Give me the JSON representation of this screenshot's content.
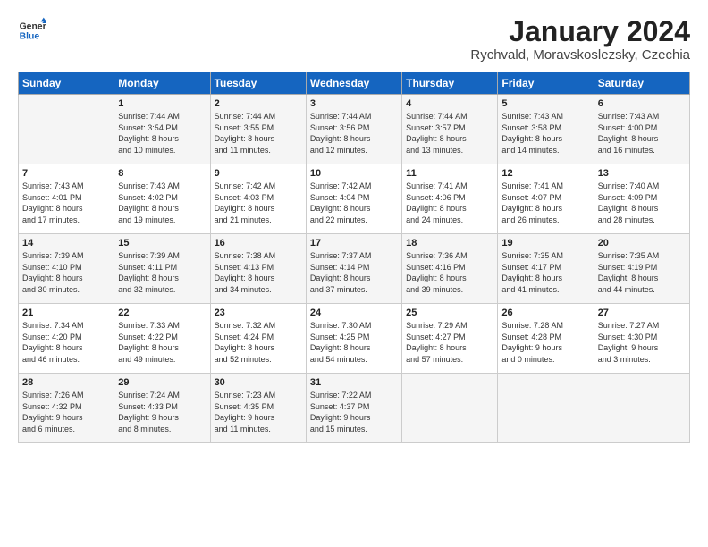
{
  "logo": {
    "line1": "General",
    "line2": "Blue"
  },
  "title": "January 2024",
  "subtitle": "Rychvald, Moravskoslezsky, Czechia",
  "days_of_week": [
    "Sunday",
    "Monday",
    "Tuesday",
    "Wednesday",
    "Thursday",
    "Friday",
    "Saturday"
  ],
  "weeks": [
    [
      {
        "day": "",
        "info": ""
      },
      {
        "day": "1",
        "info": "Sunrise: 7:44 AM\nSunset: 3:54 PM\nDaylight: 8 hours\nand 10 minutes."
      },
      {
        "day": "2",
        "info": "Sunrise: 7:44 AM\nSunset: 3:55 PM\nDaylight: 8 hours\nand 11 minutes."
      },
      {
        "day": "3",
        "info": "Sunrise: 7:44 AM\nSunset: 3:56 PM\nDaylight: 8 hours\nand 12 minutes."
      },
      {
        "day": "4",
        "info": "Sunrise: 7:44 AM\nSunset: 3:57 PM\nDaylight: 8 hours\nand 13 minutes."
      },
      {
        "day": "5",
        "info": "Sunrise: 7:43 AM\nSunset: 3:58 PM\nDaylight: 8 hours\nand 14 minutes."
      },
      {
        "day": "6",
        "info": "Sunrise: 7:43 AM\nSunset: 4:00 PM\nDaylight: 8 hours\nand 16 minutes."
      }
    ],
    [
      {
        "day": "7",
        "info": "Sunrise: 7:43 AM\nSunset: 4:01 PM\nDaylight: 8 hours\nand 17 minutes."
      },
      {
        "day": "8",
        "info": "Sunrise: 7:43 AM\nSunset: 4:02 PM\nDaylight: 8 hours\nand 19 minutes."
      },
      {
        "day": "9",
        "info": "Sunrise: 7:42 AM\nSunset: 4:03 PM\nDaylight: 8 hours\nand 21 minutes."
      },
      {
        "day": "10",
        "info": "Sunrise: 7:42 AM\nSunset: 4:04 PM\nDaylight: 8 hours\nand 22 minutes."
      },
      {
        "day": "11",
        "info": "Sunrise: 7:41 AM\nSunset: 4:06 PM\nDaylight: 8 hours\nand 24 minutes."
      },
      {
        "day": "12",
        "info": "Sunrise: 7:41 AM\nSunset: 4:07 PM\nDaylight: 8 hours\nand 26 minutes."
      },
      {
        "day": "13",
        "info": "Sunrise: 7:40 AM\nSunset: 4:09 PM\nDaylight: 8 hours\nand 28 minutes."
      }
    ],
    [
      {
        "day": "14",
        "info": "Sunrise: 7:39 AM\nSunset: 4:10 PM\nDaylight: 8 hours\nand 30 minutes."
      },
      {
        "day": "15",
        "info": "Sunrise: 7:39 AM\nSunset: 4:11 PM\nDaylight: 8 hours\nand 32 minutes."
      },
      {
        "day": "16",
        "info": "Sunrise: 7:38 AM\nSunset: 4:13 PM\nDaylight: 8 hours\nand 34 minutes."
      },
      {
        "day": "17",
        "info": "Sunrise: 7:37 AM\nSunset: 4:14 PM\nDaylight: 8 hours\nand 37 minutes."
      },
      {
        "day": "18",
        "info": "Sunrise: 7:36 AM\nSunset: 4:16 PM\nDaylight: 8 hours\nand 39 minutes."
      },
      {
        "day": "19",
        "info": "Sunrise: 7:35 AM\nSunset: 4:17 PM\nDaylight: 8 hours\nand 41 minutes."
      },
      {
        "day": "20",
        "info": "Sunrise: 7:35 AM\nSunset: 4:19 PM\nDaylight: 8 hours\nand 44 minutes."
      }
    ],
    [
      {
        "day": "21",
        "info": "Sunrise: 7:34 AM\nSunset: 4:20 PM\nDaylight: 8 hours\nand 46 minutes."
      },
      {
        "day": "22",
        "info": "Sunrise: 7:33 AM\nSunset: 4:22 PM\nDaylight: 8 hours\nand 49 minutes."
      },
      {
        "day": "23",
        "info": "Sunrise: 7:32 AM\nSunset: 4:24 PM\nDaylight: 8 hours\nand 52 minutes."
      },
      {
        "day": "24",
        "info": "Sunrise: 7:30 AM\nSunset: 4:25 PM\nDaylight: 8 hours\nand 54 minutes."
      },
      {
        "day": "25",
        "info": "Sunrise: 7:29 AM\nSunset: 4:27 PM\nDaylight: 8 hours\nand 57 minutes."
      },
      {
        "day": "26",
        "info": "Sunrise: 7:28 AM\nSunset: 4:28 PM\nDaylight: 9 hours\nand 0 minutes."
      },
      {
        "day": "27",
        "info": "Sunrise: 7:27 AM\nSunset: 4:30 PM\nDaylight: 9 hours\nand 3 minutes."
      }
    ],
    [
      {
        "day": "28",
        "info": "Sunrise: 7:26 AM\nSunset: 4:32 PM\nDaylight: 9 hours\nand 6 minutes."
      },
      {
        "day": "29",
        "info": "Sunrise: 7:24 AM\nSunset: 4:33 PM\nDaylight: 9 hours\nand 8 minutes."
      },
      {
        "day": "30",
        "info": "Sunrise: 7:23 AM\nSunset: 4:35 PM\nDaylight: 9 hours\nand 11 minutes."
      },
      {
        "day": "31",
        "info": "Sunrise: 7:22 AM\nSunset: 4:37 PM\nDaylight: 9 hours\nand 15 minutes."
      },
      {
        "day": "",
        "info": ""
      },
      {
        "day": "",
        "info": ""
      },
      {
        "day": "",
        "info": ""
      }
    ]
  ]
}
